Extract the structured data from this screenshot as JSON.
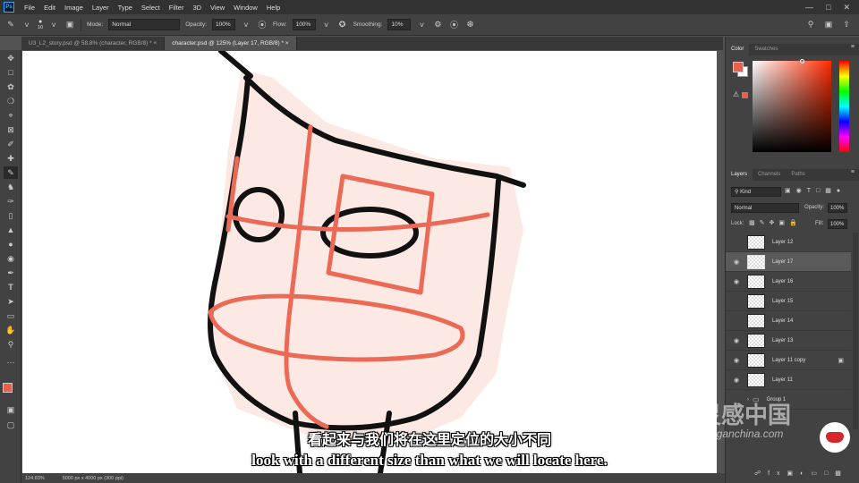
{
  "app": {
    "logo": "Ps"
  },
  "menu": [
    "File",
    "Edit",
    "Image",
    "Layer",
    "Type",
    "Select",
    "Filter",
    "3D",
    "View",
    "Window",
    "Help"
  ],
  "options": {
    "brush_size": "10",
    "mode_label": "Mode:",
    "mode_value": "Normal",
    "opacity_label": "Opacity:",
    "opacity_value": "100%",
    "flow_label": "Flow:",
    "flow_value": "100%",
    "smoothing_label": "Smoothing:",
    "smoothing_value": "10%"
  },
  "tabs": [
    {
      "label": "U3_L2_story.psd @ 58.8% (character, RGB/8) *",
      "active": false
    },
    {
      "label": "character.psd @ 125% (Layer 17, RGB/8) *",
      "active": true
    }
  ],
  "status": {
    "zoom": "124.83%",
    "doc_size": "5000 px x 4000 px (300 ppi)"
  },
  "color_panel": {
    "tabs": [
      "Color",
      "Swatches"
    ],
    "foreground": "#e8604c",
    "background": "#ffffff"
  },
  "layers_panel": {
    "tabs": [
      "Layers",
      "Channels",
      "Paths"
    ],
    "filter_label": "Kind",
    "blend_mode": "Normal",
    "opacity_label": "Opacity:",
    "opacity_value": "100%",
    "lock_label": "Lock:",
    "fill_label": "Fill:",
    "fill_value": "100%",
    "layers": [
      {
        "name": "Layer 12",
        "visible": false,
        "selected": false
      },
      {
        "name": "Layer 17",
        "visible": true,
        "selected": true
      },
      {
        "name": "Layer 16",
        "visible": true,
        "selected": false
      },
      {
        "name": "Layer 15",
        "visible": false,
        "selected": false
      },
      {
        "name": "Layer 14",
        "visible": false,
        "selected": false
      },
      {
        "name": "Layer 13",
        "visible": true,
        "selected": false
      },
      {
        "name": "Layer 11 copy",
        "visible": true,
        "selected": false,
        "locked": true
      },
      {
        "name": "Layer 11",
        "visible": true,
        "selected": false
      },
      {
        "name": "Group 1",
        "visible": false,
        "selected": false
      }
    ]
  },
  "subtitles": {
    "cn": "看起来与我们将在这里定位的大小不同",
    "en": "look with a different size than what we will locate here."
  },
  "watermark": {
    "brand_cn": "灵感中国",
    "url": "lingganchina.com"
  },
  "colors": {
    "sketch_red": "#ec6a55",
    "sketch_black": "#111111",
    "glow": "#fde3dc",
    "accent": "#31a8ff"
  }
}
